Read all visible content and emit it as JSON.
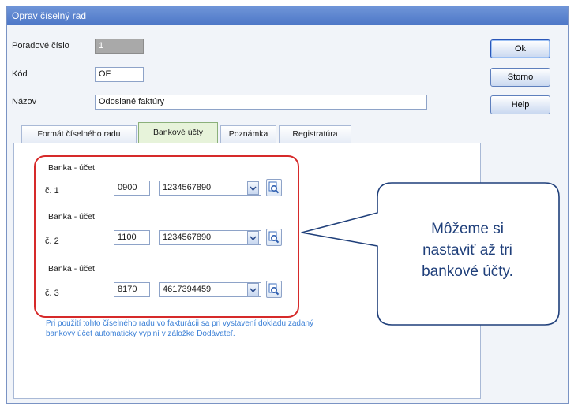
{
  "window": {
    "title": "Oprav číselný rad"
  },
  "fields": {
    "poradove_cislo": {
      "label": "Poradové číslo",
      "value": "1"
    },
    "kod": {
      "label": "Kód",
      "value": "OF"
    },
    "nazov": {
      "label": "Názov",
      "value": "Odoslané faktúry"
    }
  },
  "buttons": {
    "ok": "Ok",
    "storno": "Storno",
    "help": "Help"
  },
  "tabs": [
    {
      "label": "Formát číselného radu",
      "active": false
    },
    {
      "label": "Bankové účty",
      "active": true
    },
    {
      "label": "Poznámka",
      "active": false
    },
    {
      "label": "Registratúra",
      "active": false
    }
  ],
  "bank_accounts": [
    {
      "group_label": "Banka - účet",
      "row_label": "č. 1",
      "bank_code": "0900",
      "account": "1234567890"
    },
    {
      "group_label": "Banka - účet",
      "row_label": "č. 2",
      "bank_code": "1100",
      "account": "1234567890"
    },
    {
      "group_label": "Banka - účet",
      "row_label": "č. 3",
      "bank_code": "8170",
      "account": "4617394459"
    }
  ],
  "info_note": "Pri použití tohto číselného radu vo fakturácii sa pri vystavení dokladu zadaný bankový účet automaticky vyplní v záložke Dodávateľ.",
  "callout": {
    "line1": "Môžeme si",
    "line2": "nastaviť až tri",
    "line3": "bankové účty."
  },
  "colors": {
    "title_bar": "#5a82cc",
    "highlight_outline": "#d62a2a",
    "callout_border": "#1f3f7a",
    "note_text": "#3a7fd6",
    "active_tab": "#e7f3da"
  },
  "icons": {
    "combo": "chevron-down-icon",
    "lookup": "magnifier-icon"
  }
}
